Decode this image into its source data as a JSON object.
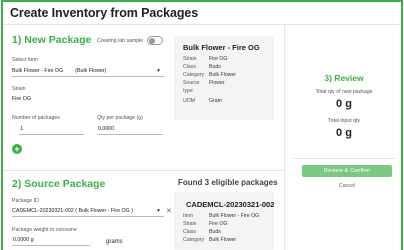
{
  "page": {
    "title": "Create Inventory from Packages"
  },
  "new_package": {
    "section_title": "1) New Package",
    "lab_sample_label": "Creating lab sample",
    "select_item_label": "Select Item",
    "select_item_value": "Bulk Flower - Fire OG",
    "select_item_type": "(Bulk Flower)",
    "strain_label": "Strain",
    "strain_value": "Fire OG",
    "num_packages_label": "Number of packages",
    "num_packages_value": "1",
    "qty_per_package_label": "Qty per package (g)",
    "qty_per_package_value": "0.0000"
  },
  "item_card": {
    "title": "Bulk Flower - Fire OG",
    "rows": [
      {
        "k": "Strain",
        "v": "Fire OG"
      },
      {
        "k": "Class",
        "v": "Buds"
      },
      {
        "k": "Category",
        "v": "Bulk Flower"
      },
      {
        "k": "Source",
        "v": "Flower"
      },
      {
        "k": "type",
        "v": ""
      },
      {
        "k": "UOM",
        "v": "Gram"
      }
    ]
  },
  "review": {
    "title": "3) Review",
    "new_package_label": "Total qty of new package",
    "new_package_value": "0 g",
    "input_label": "Total input qty",
    "input_value": "0 g",
    "confirm_label": "Review & Confirm",
    "cancel_label": "Cancel"
  },
  "source_package": {
    "section_title": "2) Source Package",
    "package_id_label": "Package ID",
    "package_id_value": "CADEMCL-20230321-002 ( Bulk Flower - Fire OG )",
    "weight_label": "Package weight to consume",
    "weight_value": "0.0000 g",
    "weight_unit": "grams"
  },
  "eligible": {
    "found_text": "Found 3 eligible packages",
    "card_title": "CADEMCL-20230321-002",
    "rows": [
      {
        "k": "Item",
        "v": "Bulk Flower - Fire OG"
      },
      {
        "k": "Strain",
        "v": "Fire OG"
      },
      {
        "k": "Class",
        "v": "Buds"
      },
      {
        "k": "Category",
        "v": "Bulk Flower"
      }
    ]
  },
  "colors": {
    "accent": "#3fae49",
    "button": "#7cc784",
    "card_bg": "#f4f4f4"
  },
  "icons": {
    "add": "plus-circle-icon",
    "select_caret": "caret-down-icon",
    "clear": "close-icon"
  }
}
